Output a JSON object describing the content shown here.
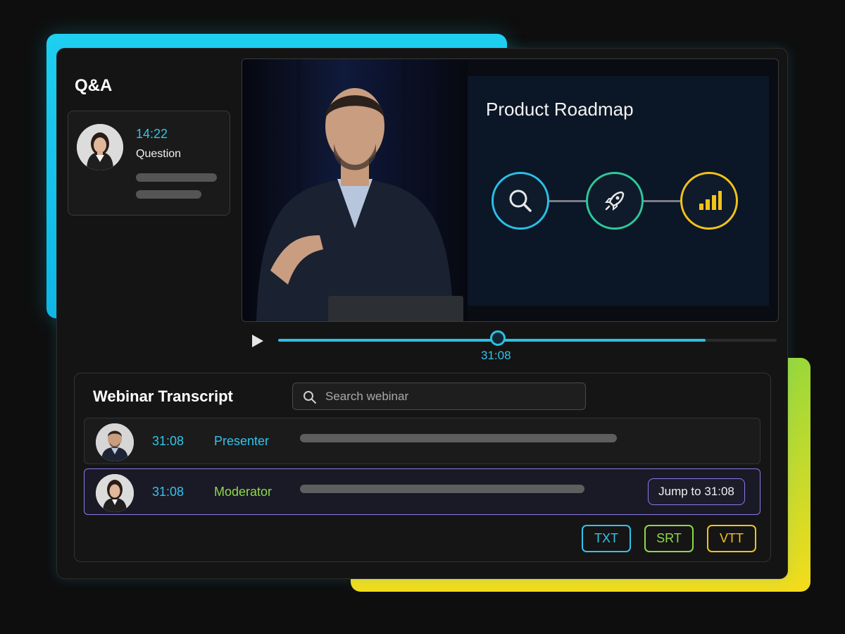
{
  "qa": {
    "title": "Q&A",
    "card": {
      "time": "14:22",
      "label": "Question"
    }
  },
  "video": {
    "slide": {
      "title": "Product Roadmap",
      "steps": [
        {
          "icon": "search-icon",
          "color": "#2bbfe6"
        },
        {
          "icon": "rocket-icon",
          "color": "#2fc79a"
        },
        {
          "icon": "bar-chart-icon",
          "color": "#f2c21b"
        }
      ]
    }
  },
  "player": {
    "current_time": "31:08",
    "progress": 0.44,
    "buffered": 0.857
  },
  "transcript": {
    "title": "Webinar Transcript",
    "search_placeholder": "Search webinar",
    "rows": [
      {
        "time": "31:08",
        "role": "Presenter",
        "role_color": "#33c3ea",
        "selected": false
      },
      {
        "time": "31:08",
        "role": "Moderator",
        "role_color": "#8fd84a",
        "selected": true,
        "action": "Jump to 31:08"
      }
    ],
    "export": [
      {
        "label": "TXT",
        "color": "#33c3ea"
      },
      {
        "label": "SRT",
        "color": "#8fd84a"
      },
      {
        "label": "VTT",
        "color": "#f2c21b"
      }
    ]
  },
  "colors": {
    "accent_cyan": "#2bbfe6",
    "accent_green": "#8fd84a",
    "accent_yellow": "#f2c21b",
    "accent_purple": "#8a78e8"
  }
}
